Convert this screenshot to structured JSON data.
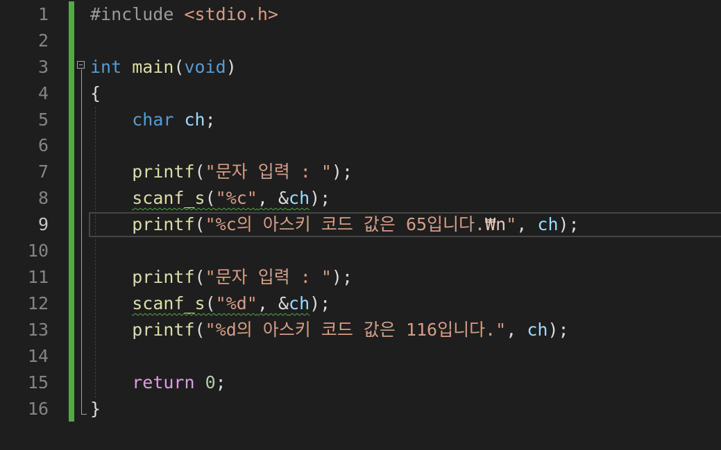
{
  "editor": {
    "active_line": 9,
    "line_numbers": [
      "1",
      "2",
      "3",
      "4",
      "5",
      "6",
      "7",
      "8",
      "9",
      "10",
      "11",
      "12",
      "13",
      "14",
      "15",
      "16"
    ],
    "colors": {
      "background": "#1e1e1e",
      "change_bar": "#57a64a",
      "keyword": "#569cd6",
      "function": "#dcdcaa",
      "string": "#d69d85",
      "variable": "#9cdcfe",
      "number": "#b5cea8",
      "control_keyword": "#d8a0df"
    },
    "lines": {
      "l1": {
        "directive": "#include",
        "header": "<stdio.h>"
      },
      "l3": {
        "type": "int",
        "name": "main",
        "open": "(",
        "param": "void",
        "close": ")"
      },
      "l4": {
        "brace": "{"
      },
      "l5": {
        "type": "char",
        "var": "ch",
        "semi": ";"
      },
      "l7": {
        "fn": "printf",
        "open": "(",
        "str": "\"문자 입력 : \"",
        "close": ");"
      },
      "l8": {
        "fn": "scanf_s",
        "open": "(",
        "str": "\"%c\"",
        "sep": ", &",
        "var": "ch",
        "close": ");"
      },
      "l9": {
        "fn": "printf",
        "open": "(",
        "str_a": "\"%c의 아스키 코드 값은 65입니다.",
        "esc": "₩n",
        "str_b": "\"",
        "sep": ", ",
        "var": "ch",
        "close": ");"
      },
      "l11": {
        "fn": "printf",
        "open": "(",
        "str": "\"문자 입력 : \"",
        "close": ");"
      },
      "l12": {
        "fn": "scanf_s",
        "open": "(",
        "str": "\"%d\"",
        "sep": ", &",
        "var": "ch",
        "close": ");"
      },
      "l13": {
        "fn": "printf",
        "open": "(",
        "str": "\"%d의 아스키 코드 값은 116입니다.\"",
        "sep": ", ",
        "var": "ch",
        "close": ");"
      },
      "l15": {
        "kw": "return",
        "num": "0",
        "semi": ";"
      },
      "l16": {
        "brace": "}"
      }
    }
  }
}
